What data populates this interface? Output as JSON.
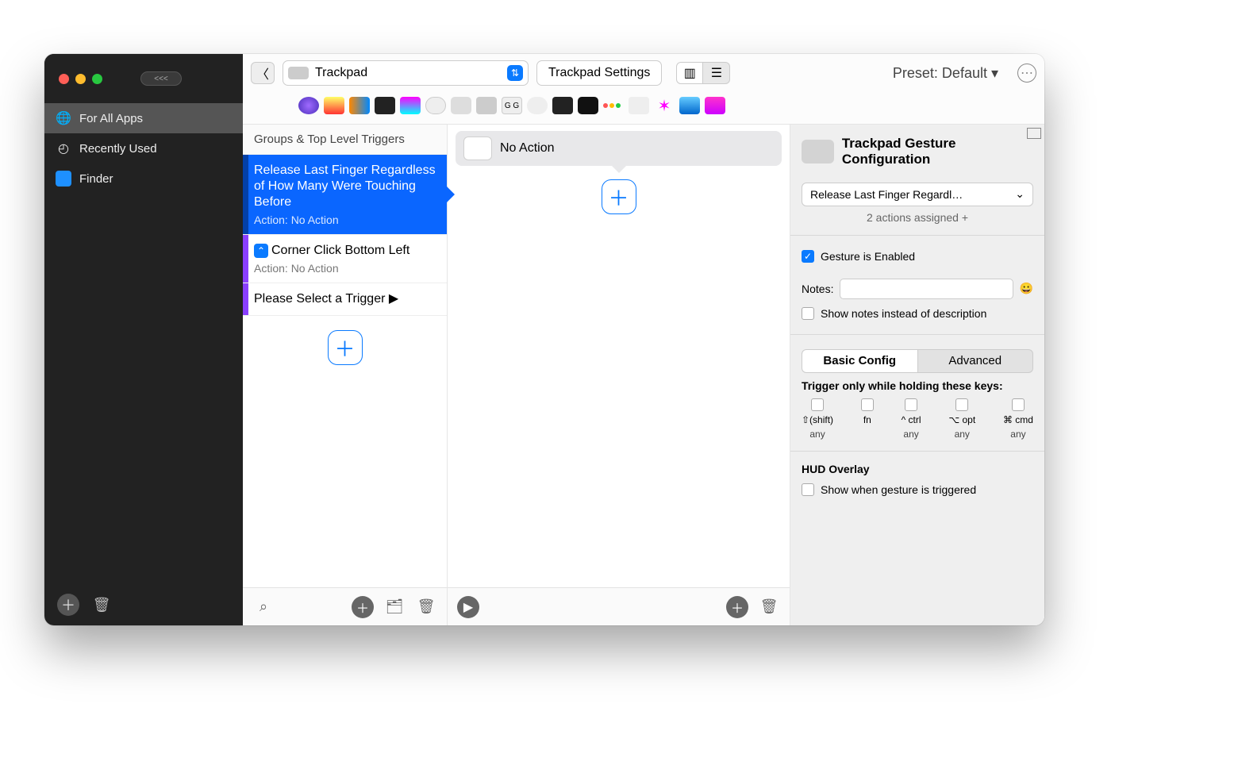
{
  "sidebar": {
    "collapse_label": "<<<",
    "items": [
      {
        "label": "For All Apps",
        "icon": "globe-icon",
        "selected": true
      },
      {
        "label": "Recently Used",
        "icon": "clock-icon",
        "selected": false
      },
      {
        "label": "Finder",
        "icon": "finder-icon",
        "selected": false
      }
    ]
  },
  "toolbar": {
    "trigger_type": "Trackpad",
    "settings_button": "Trackpad Settings",
    "preset_label": "Preset: Default ▾"
  },
  "triggers": {
    "header": "Groups & Top Level Triggers",
    "items": [
      {
        "title": "Release Last Finger Regardless of How Many Were Touching Before",
        "subtitle": "Action: No Action",
        "selected": true,
        "stripe": "#0340a8"
      },
      {
        "title": "Corner Click Bottom Left",
        "subtitle": "Action: No Action",
        "selected": false,
        "stripe": "#8a3fff",
        "badge": "corner-icon"
      },
      {
        "title": "Please Select a Trigger ▶",
        "subtitle": "",
        "selected": false,
        "stripe": "#8a3fff"
      }
    ]
  },
  "actions": {
    "items": [
      {
        "label": "No Action"
      }
    ]
  },
  "config": {
    "title": "Trackpad Gesture Configuration",
    "gesture_select": "Release Last Finger Regardl…",
    "actions_assigned": "2 actions assigned +",
    "enabled_label": "Gesture is Enabled",
    "notes_label": "Notes:",
    "show_notes_label": "Show notes instead of description",
    "tabs": {
      "basic": "Basic Config",
      "advanced": "Advanced"
    },
    "hold_keys_header": "Trigger only while holding these keys:",
    "modifiers": [
      {
        "label": "⇧(shift)",
        "any": "any"
      },
      {
        "label": "fn",
        "any": ""
      },
      {
        "label": "^ ctrl",
        "any": "any"
      },
      {
        "label": "⌥ opt",
        "any": "any"
      },
      {
        "label": "⌘ cmd",
        "any": "any"
      }
    ],
    "hud_header": "HUD Overlay",
    "hud_show_label": "Show when gesture is triggered"
  }
}
